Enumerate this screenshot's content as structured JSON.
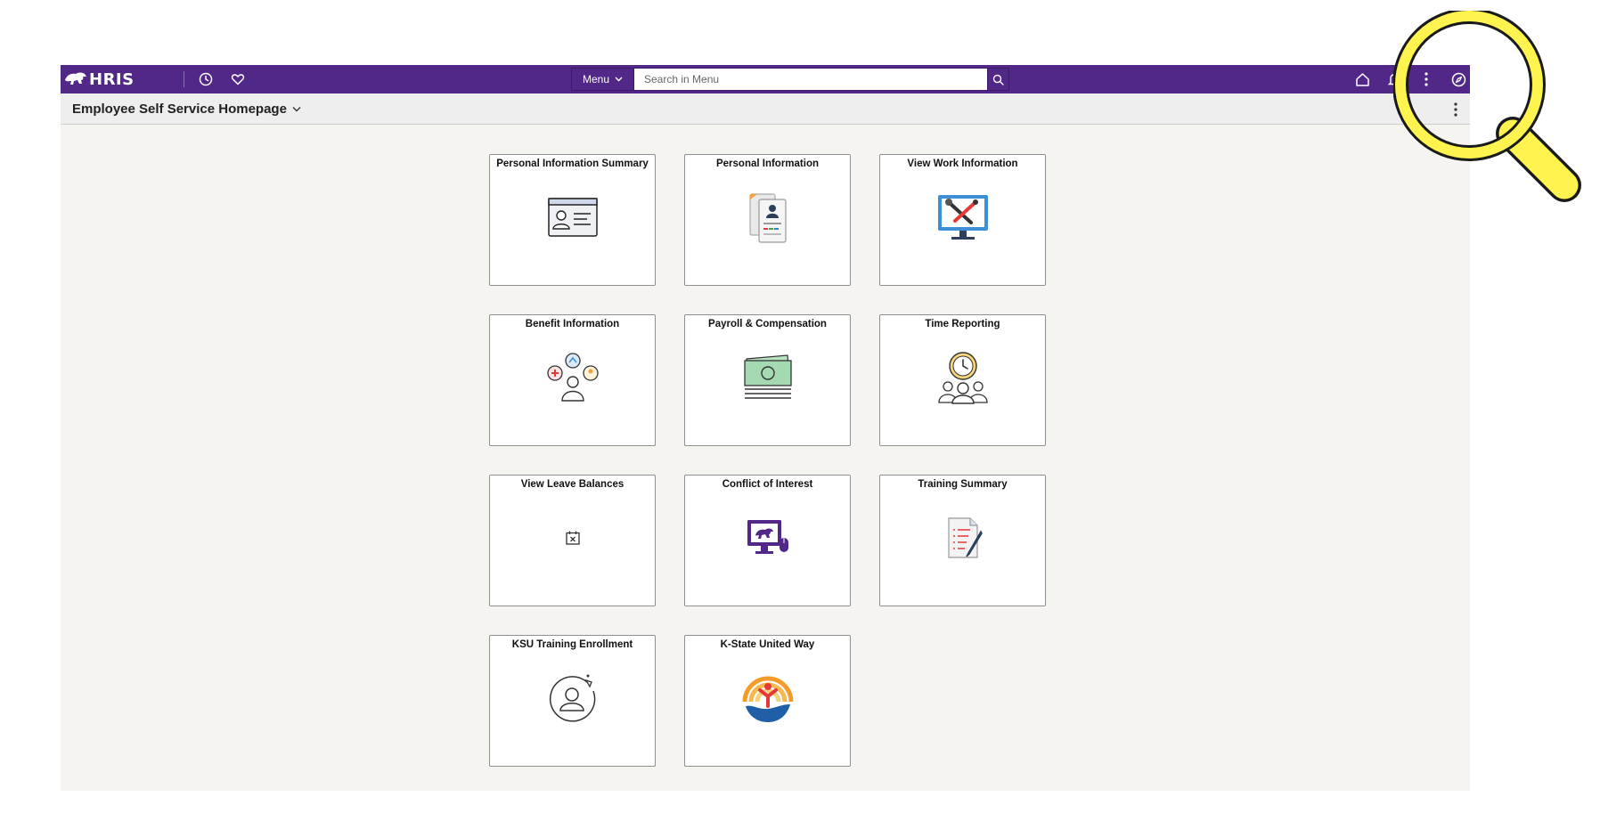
{
  "topbar": {
    "logo_text": "HRIS",
    "menu_label": "Menu",
    "search_placeholder": "Search in Menu"
  },
  "page": {
    "title": "Employee Self Service Homepage"
  },
  "tiles": [
    {
      "label": "Personal Information Summary",
      "icon": "id-card-icon"
    },
    {
      "label": "Personal Information",
      "icon": "personal-documents-icon"
    },
    {
      "label": "View Work Information",
      "icon": "work-monitor-tools-icon"
    },
    {
      "label": "Benefit Information",
      "icon": "benefits-people-icon"
    },
    {
      "label": "Payroll & Compensation",
      "icon": "cash-money-icon"
    },
    {
      "label": "Time Reporting",
      "icon": "clock-people-icon"
    },
    {
      "label": "View Leave Balances",
      "icon": "calendar-x-icon"
    },
    {
      "label": "Conflict of Interest",
      "icon": "computer-mouse-icon"
    },
    {
      "label": "Training Summary",
      "icon": "document-pen-icon"
    },
    {
      "label": "KSU Training Enrollment",
      "icon": "person-circle-arrow-icon"
    },
    {
      "label": "K-State United Way",
      "icon": "united-way-logo-icon"
    }
  ],
  "colors": {
    "brand_purple": "#512888",
    "page_background": "#f5f4f1",
    "magnifier_yellow": "#fff44f"
  }
}
